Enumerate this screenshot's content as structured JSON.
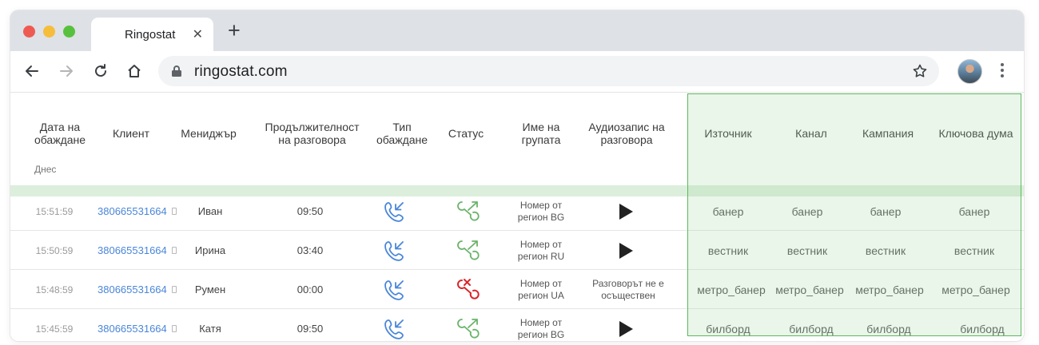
{
  "browser": {
    "tab_title": "Ringostat",
    "tab_close": "✕",
    "new_tab": "+",
    "url": "ringostat.com"
  },
  "table": {
    "headers": {
      "date": "Дата на обаждане",
      "client": "Клиент",
      "manager": "Мениджър",
      "duration": "Продължителност на разговора",
      "call_type": "Тип обаждане",
      "status": "Статус",
      "group": "Име на групата",
      "audio": "Аудиозапис на разговора",
      "source": "Източник",
      "channel": "Канал",
      "campaign": "Кампания",
      "keyword": "Ключова дума"
    },
    "today_label": "Днес",
    "rows": [
      {
        "time": "15:51:59",
        "phone": "380665531664",
        "manager": "Иван",
        "duration": "09:50",
        "status": "success",
        "group": "Номер от регион BG",
        "audio": "play",
        "source": "банер",
        "channel": "банер",
        "campaign": "банер",
        "keyword": "банер"
      },
      {
        "time": "15:50:59",
        "phone": "380665531664",
        "manager": "Ирина",
        "duration": "03:40",
        "status": "success",
        "group": "Номер от регион  RU",
        "audio": "play",
        "source": "вестник",
        "channel": "вестник",
        "campaign": "вестник",
        "keyword": "вестник"
      },
      {
        "time": "15:48:59",
        "phone": "380665531664",
        "manager": "Румен",
        "duration": "00:00",
        "status": "failed",
        "group": "Номер от регион  UA",
        "audio_text": "Разговорът не е осъществен",
        "source": "метро_банер",
        "channel": "метро_банер",
        "campaign": "метро_банер",
        "keyword": "метро_банер"
      },
      {
        "time": "15:45:59",
        "phone": "380665531664",
        "manager": "Катя",
        "duration": "09:50",
        "status": "success",
        "group": "Номер от регион BG",
        "audio": "play",
        "source": "билборд",
        "channel": "билборд",
        "campaign": "билборд",
        "keyword": "билборд"
      }
    ]
  },
  "colors": {
    "incoming_icon": "#4a86d9",
    "success_icon": "#6bb36b",
    "failed_icon": "#d9252a",
    "highlight_border": "#5cb85c",
    "phone_link": "#4a86d9"
  },
  "icons": {
    "back": "arrow-left-icon",
    "forward": "arrow-right-icon",
    "reload": "reload-icon",
    "home": "home-icon",
    "lock": "lock-icon",
    "bookmark": "star-icon",
    "menu": "more-vert-icon",
    "call_type": "incoming-call-icon",
    "status_ok": "call-success-icon",
    "status_fail": "call-failed-icon",
    "play": "play-icon",
    "copy": "copy-icon"
  }
}
